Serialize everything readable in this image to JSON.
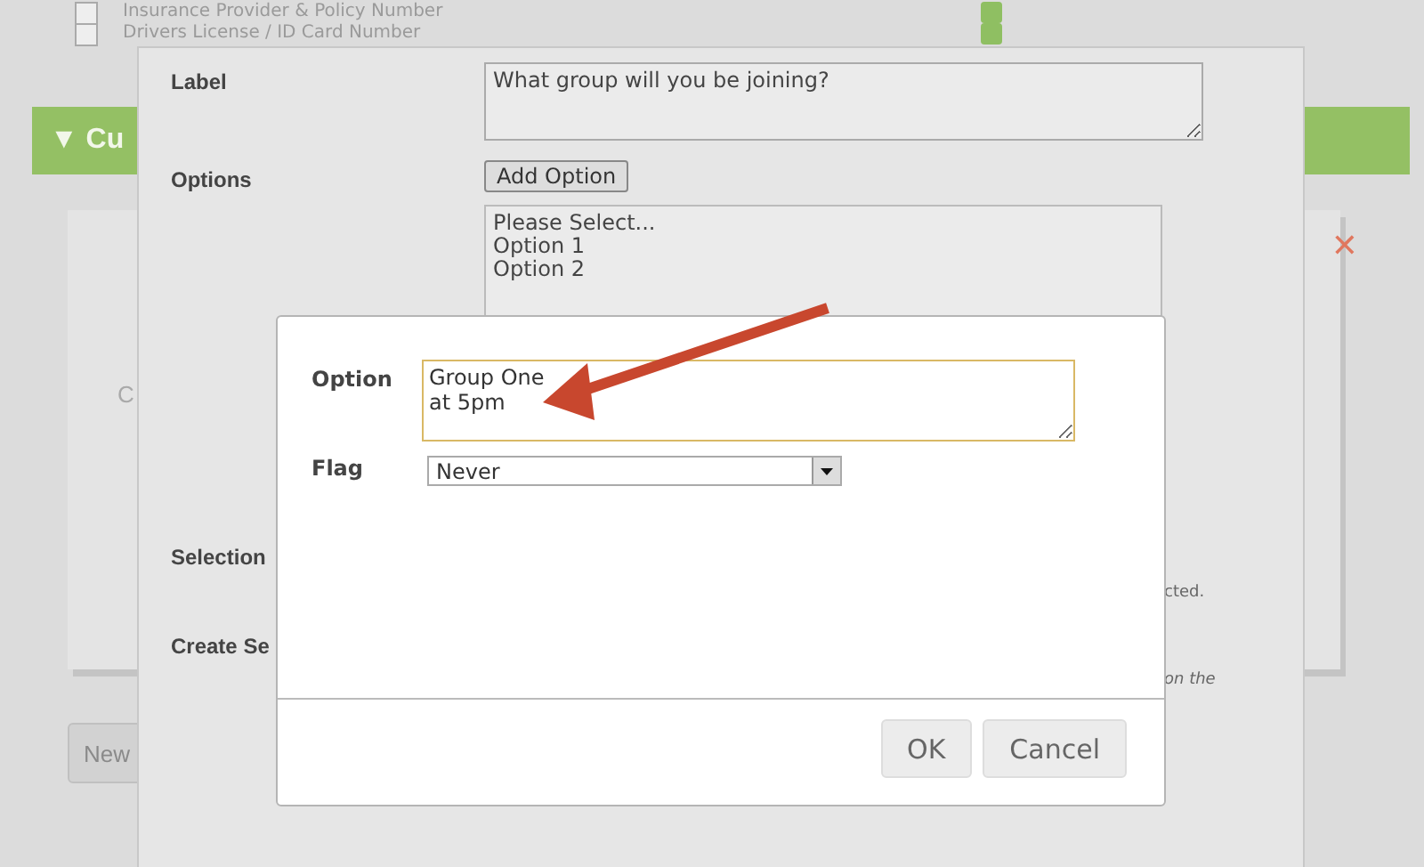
{
  "background": {
    "fields": [
      {
        "label": "Insurance Provider & Policy Number",
        "checked": false
      },
      {
        "label": "Drivers License / ID Card Number",
        "checked": false
      }
    ],
    "section_title": "▼ Cu",
    "card_texts": [
      "C"
    ],
    "close_mark": "✕",
    "new_button": "New",
    "hint_fragments": [
      "cted.",
      "on the"
    ]
  },
  "dialog": {
    "rows": [
      {
        "kind": "textarea",
        "label": "Label",
        "value": "What group will you be joining?"
      },
      {
        "kind": "options",
        "label": "Options",
        "button": "Add Option",
        "items": [
          "Please Select...",
          "Option 1",
          "Option 2"
        ]
      },
      {
        "kind": "plain",
        "label": "Selection"
      },
      {
        "kind": "plain",
        "label": "Create Se"
      }
    ]
  },
  "option_dialog": {
    "option_label": "Option",
    "option_value": "Group One\nat 5pm",
    "flag_label": "Flag",
    "flag_value": "Never",
    "buttons": [
      "OK",
      "Cancel"
    ]
  }
}
